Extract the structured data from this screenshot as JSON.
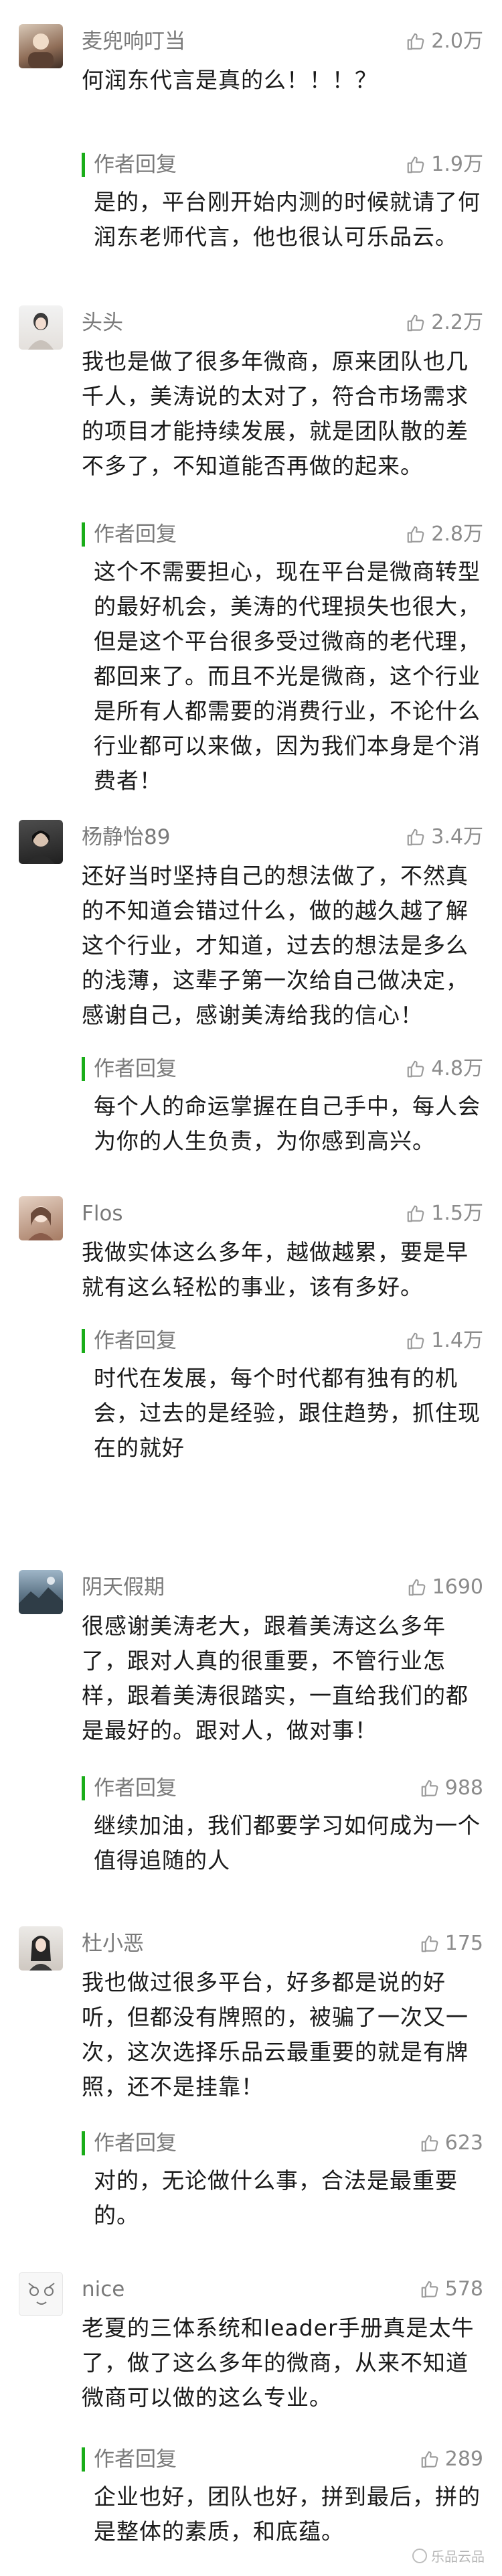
{
  "colors": {
    "accent": "#1aad19",
    "meta_text": "#7a7a7a",
    "body_text": "#1a1a1a"
  },
  "icons": {
    "like": "thumbs-up-icon"
  },
  "comments": [
    {
      "username": "麦兜响叮当",
      "likes": "2.0万",
      "text": "何润东代言是真的么！！！？",
      "reply": {
        "label": "作者回复",
        "likes": "1.9万",
        "text": "是的，平台刚开始内测的时候就请了何润东老师代言，他也很认可乐品云。"
      }
    },
    {
      "username": "头头",
      "likes": "2.2万",
      "text": "我也是做了很多年微商，原来团队也几千人，美涛说的太对了，符合市场需求的项目才能持续发展，就是团队散的差不多了，不知道能否再做的起来。",
      "reply": {
        "label": "作者回复",
        "likes": "2.8万",
        "text": "这个不需要担心，现在平台是微商转型的最好机会，美涛的代理损失也很大，但是这个平台很多受过微商的老代理，都回来了。而且不光是微商，这个行业是所有人都需要的消费行业，不论什么行业都可以来做，因为我们本身是个消费者！"
      }
    },
    {
      "username": "杨静怡89",
      "likes": "3.4万",
      "text": "还好当时坚持自己的想法做了，不然真的不知道会错过什么，做的越久越了解这个行业，才知道，过去的想法是多么的浅薄，这辈子第一次给自己做决定，感谢自己，感谢美涛给我的信心！",
      "reply": {
        "label": "作者回复",
        "likes": "4.8万",
        "text": "每个人的命运掌握在自己手中，每人会为你的人生负责，为你感到高兴。"
      }
    },
    {
      "username": "Flos",
      "likes": "1.5万",
      "text": "我做实体这么多年，越做越累，要是早就有这么轻松的事业，该有多好。",
      "reply": {
        "label": "作者回复",
        "likes": "1.4万",
        "text": "时代在发展，每个时代都有独有的机会，过去的是经验，跟住趋势，抓住现在的就好"
      }
    },
    {
      "username": "阴天假期",
      "likes": "1690",
      "text": "很感谢美涛老大，跟着美涛这么多年了，跟对人真的很重要，不管行业怎样，跟着美涛很踏实，一直给我们的都是最好的。跟对人，做对事！",
      "reply": {
        "label": "作者回复",
        "likes": "988",
        "text": "继续加油，我们都要学习如何成为一个值得追随的人"
      }
    },
    {
      "username": "杜小恶",
      "likes": "175",
      "text": "我也做过很多平台，好多都是说的好听，但都没有牌照的，被骗了一次又一次，这次选择乐品云最重要的就是有牌照，还不是挂靠！",
      "reply": {
        "label": "作者回复",
        "likes": "623",
        "text": "对的，无论做什么事，合法是最重要的。"
      }
    },
    {
      "username": "nice",
      "likes": "578",
      "text": "老夏的三体系统和leader手册真是太牛了，做了这么多年的微商，从来不知道微商可以做的这么专业。",
      "reply": {
        "label": "作者回复",
        "likes": "289",
        "text": "企业也好，团队也好，拼到最后，拼的是整体的素质，和底蕴。"
      }
    }
  ],
  "watermark": "乐品云品"
}
